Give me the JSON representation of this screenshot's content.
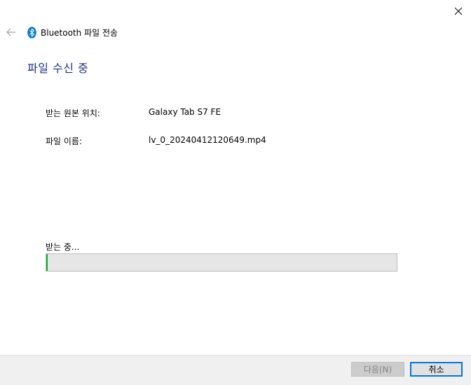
{
  "window": {
    "title": "Bluetooth 파일 전송",
    "icons": {
      "close": "close-icon",
      "back": "back-arrow-icon",
      "bluetooth": "bluetooth-icon"
    }
  },
  "main": {
    "heading": "파일 수신 중",
    "source_label": "받는 원본 위치:",
    "source_value": "Galaxy Tab S7 FE",
    "filename_label": "파일 이름:",
    "filename_value": "lv_0_20240412120649.mp4",
    "progress_label": "받는 중...",
    "progress_fraction": 0.004
  },
  "footer": {
    "next_label": "다음(N)",
    "cancel_label": "취소"
  },
  "colors": {
    "accent": "#0078d7",
    "heading": "#1e3287",
    "progress": "#06b025",
    "bluetooth": "#0a7cd4"
  }
}
